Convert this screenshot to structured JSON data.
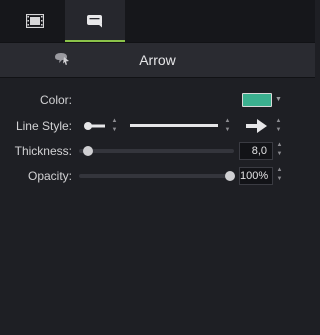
{
  "tabs": [
    {
      "icon": "film-strip-icon",
      "active": false
    },
    {
      "icon": "annotations-icon",
      "active": true
    }
  ],
  "header": {
    "icon": "annotation-style-icon",
    "title": "Arrow"
  },
  "properties": {
    "color": {
      "label": "Color:",
      "value": "#3bb08f"
    },
    "line_style": {
      "label": "Line Style:",
      "end_style": "round-dot-end",
      "line": "solid",
      "start_style": "arrow-head"
    },
    "thickness": {
      "label": "Thickness:",
      "value": "8,0",
      "level": 0.02
    },
    "opacity": {
      "label": "Opacity:",
      "value": "100%",
      "level": 1.0
    }
  },
  "colors": {
    "accent": "#8bc34a",
    "background": "#1e1f24",
    "panel": "#2a2b31"
  }
}
